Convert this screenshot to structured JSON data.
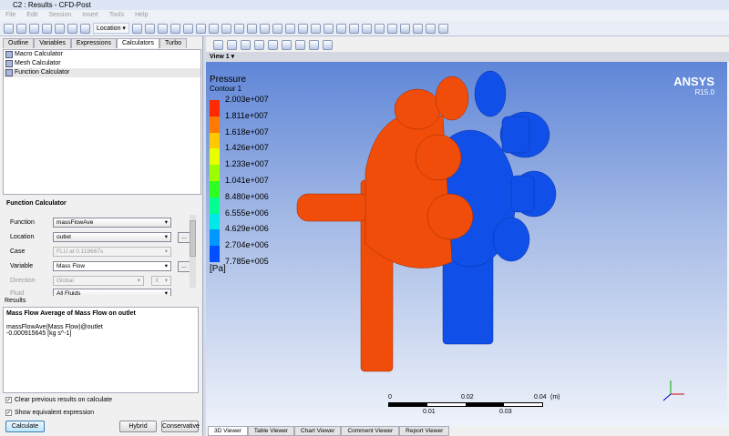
{
  "window": {
    "title": "C2 : Results - CFD-Post"
  },
  "menu": [
    "File",
    "Edit",
    "Session",
    "Insert",
    "Tools",
    "Help"
  ],
  "toolbar": {
    "location_label": "Location"
  },
  "left_tabs": [
    "Outline",
    "Variables",
    "Expressions",
    "Calculators",
    "Turbo"
  ],
  "tree": [
    "Macro Calculator",
    "Mesh Calculator",
    "Function Calculator"
  ],
  "calc": {
    "title": "Function Calculator",
    "fields": [
      {
        "label": "Function",
        "value": "massFlowAve"
      },
      {
        "label": "Location",
        "value": "outlet"
      },
      {
        "label": "Case",
        "value": "FLU at 0.119667s"
      },
      {
        "label": "Variable",
        "value": "Mass Flow"
      },
      {
        "label": "Direction",
        "value": "Global",
        "axis": "X"
      },
      {
        "label": "Fluid",
        "value": "All Fluids"
      }
    ],
    "dots": "..."
  },
  "results": {
    "label": "Results",
    "heading": "Mass Flow Average of Mass Flow on outlet",
    "expr": "massFlowAve(Mass Flow)@outlet",
    "value": "-0.000915645 [kg s^-1]"
  },
  "options": {
    "clear": "Clear previous results on calculate",
    "equiv": "Show equivalent expression"
  },
  "buttons": {
    "calculate": "Calculate",
    "hybrid": "Hybrid",
    "conservative": "Conservative"
  },
  "viewer": {
    "view_label": "View 1",
    "brand": "ANSYS",
    "version": "R15.0",
    "legend": {
      "title": "Pressure",
      "subtitle": "Contour 1",
      "unit": "[Pa]",
      "values": [
        "2.003e+007",
        "1.811e+007",
        "1.618e+007",
        "1.426e+007",
        "1.233e+007",
        "1.041e+007",
        "8.480e+006",
        "6.555e+006",
        "4.629e+006",
        "2.704e+006",
        "7.785e+005"
      ],
      "colors": [
        "#ff2a00",
        "#ff7a00",
        "#ffc800",
        "#e8ff00",
        "#9cff00",
        "#2eff20",
        "#00ff90",
        "#00e8e8",
        "#0098ff",
        "#0050ff",
        "#0010ff"
      ]
    },
    "scale": {
      "top": [
        "0",
        "0.02",
        "0.04",
        "(m)"
      ],
      "bottom": [
        "0.01",
        "0.03"
      ]
    }
  },
  "bottom_tabs": [
    "3D Viewer",
    "Table Viewer",
    "Chart Viewer",
    "Comment Viewer",
    "Report Viewer"
  ]
}
